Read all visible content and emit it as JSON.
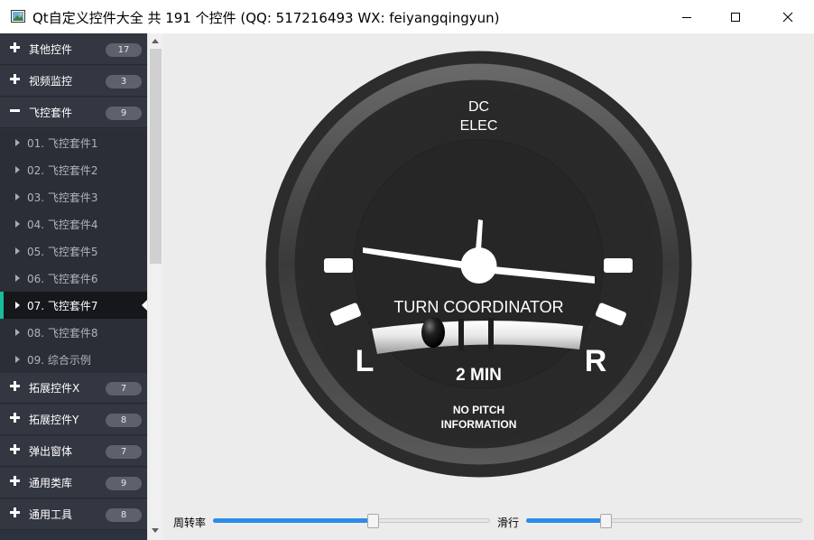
{
  "window": {
    "title": "Qt自定义控件大全 共 191 个控件 (QQ: 517216493 WX: feiyangqingyun)"
  },
  "sidebar": {
    "groups_top": [
      {
        "label": "其他控件",
        "count": "17"
      },
      {
        "label": "视频监控",
        "count": "3"
      }
    ],
    "expanded_group": {
      "label": "飞控套件",
      "count": "9"
    },
    "sub_items": [
      {
        "label": "01. 飞控套件1"
      },
      {
        "label": "02. 飞控套件2"
      },
      {
        "label": "03. 飞控套件3"
      },
      {
        "label": "04. 飞控套件4"
      },
      {
        "label": "05. 飞控套件5"
      },
      {
        "label": "06. 飞控套件6"
      },
      {
        "label": "07. 飞控套件7"
      },
      {
        "label": "08. 飞控套件8"
      },
      {
        "label": "09. 综合示例"
      }
    ],
    "active_sub_index": 6,
    "groups_bottom": [
      {
        "label": "拓展控件X",
        "count": "7"
      },
      {
        "label": "拓展控件Y",
        "count": "8"
      },
      {
        "label": "弹出窗体",
        "count": "7"
      },
      {
        "label": "通用类库",
        "count": "9"
      },
      {
        "label": "通用工具",
        "count": "8"
      }
    ]
  },
  "gauge": {
    "top_label_line1": "DC",
    "top_label_line2": "ELEC",
    "main_label": "TURN COORDINATOR",
    "left_letter": "L",
    "right_letter": "R",
    "min_label": "2 MIN",
    "bottom_line1": "NO PITCH",
    "bottom_line2": "INFORMATION"
  },
  "controls": {
    "turn_rate_label": "周转率",
    "turn_rate_value": 0.58,
    "slip_label": "滑行",
    "slip_value": 0.28
  },
  "colors": {
    "sidebar_bg": "#2e323c",
    "active_accent": "#1abc9c",
    "slider_fill": "#2b8ce6"
  }
}
